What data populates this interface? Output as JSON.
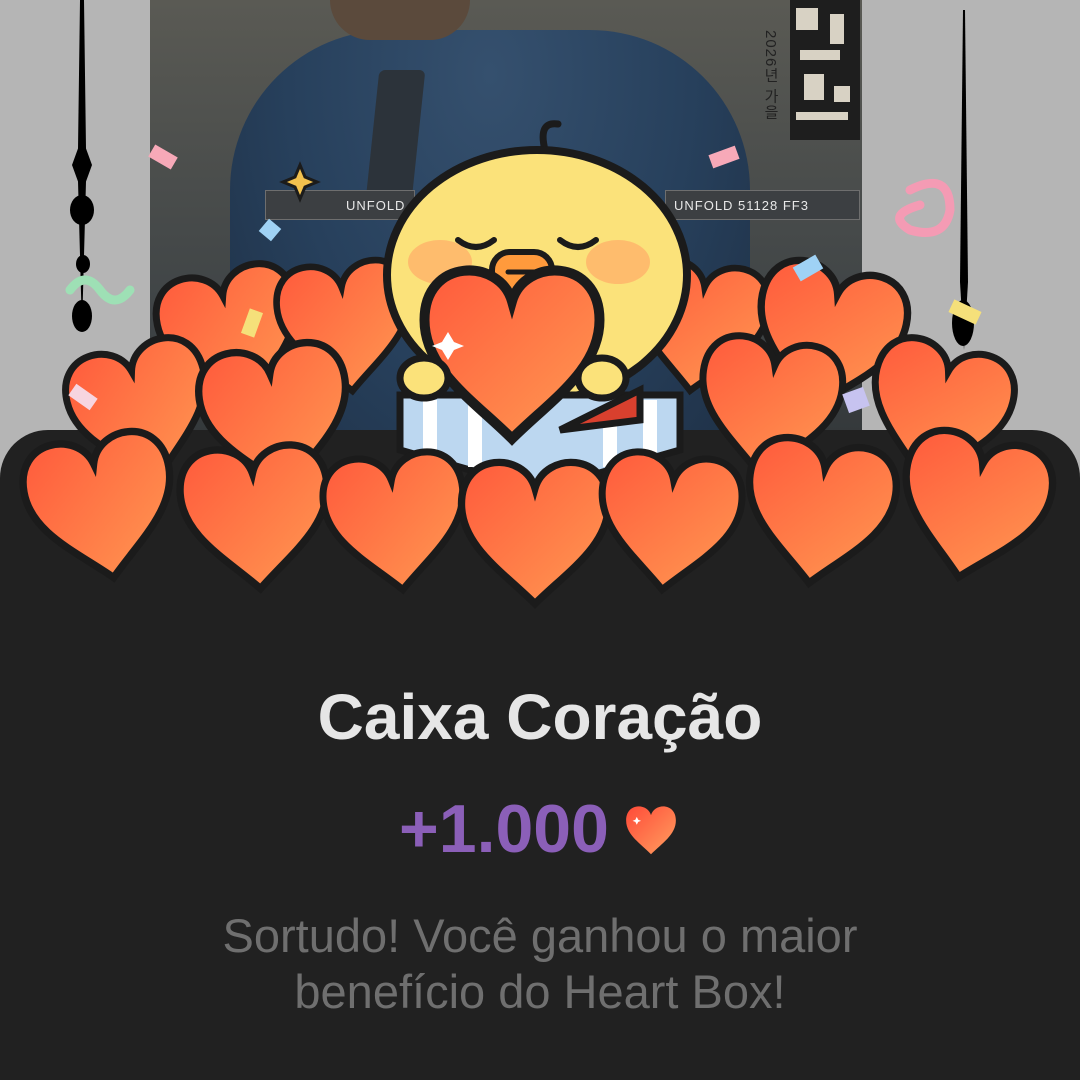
{
  "poster": {
    "strip_left": "UNFOLD",
    "strip_right": "UNFOLD  51128  FF3",
    "vertical_text": "2026년 가을"
  },
  "reward": {
    "title": "Caixa Coração",
    "amount": "+1.000",
    "amount_icon": "heart-icon",
    "message": "Sortudo! Você ganhou o maior benefício do Heart Box!"
  },
  "colors": {
    "panel_bg": "#212121",
    "title": "#e6e6e6",
    "amount": "#8b5fb8",
    "message": "#6f6f6f",
    "heart": "#ff6a3d"
  }
}
